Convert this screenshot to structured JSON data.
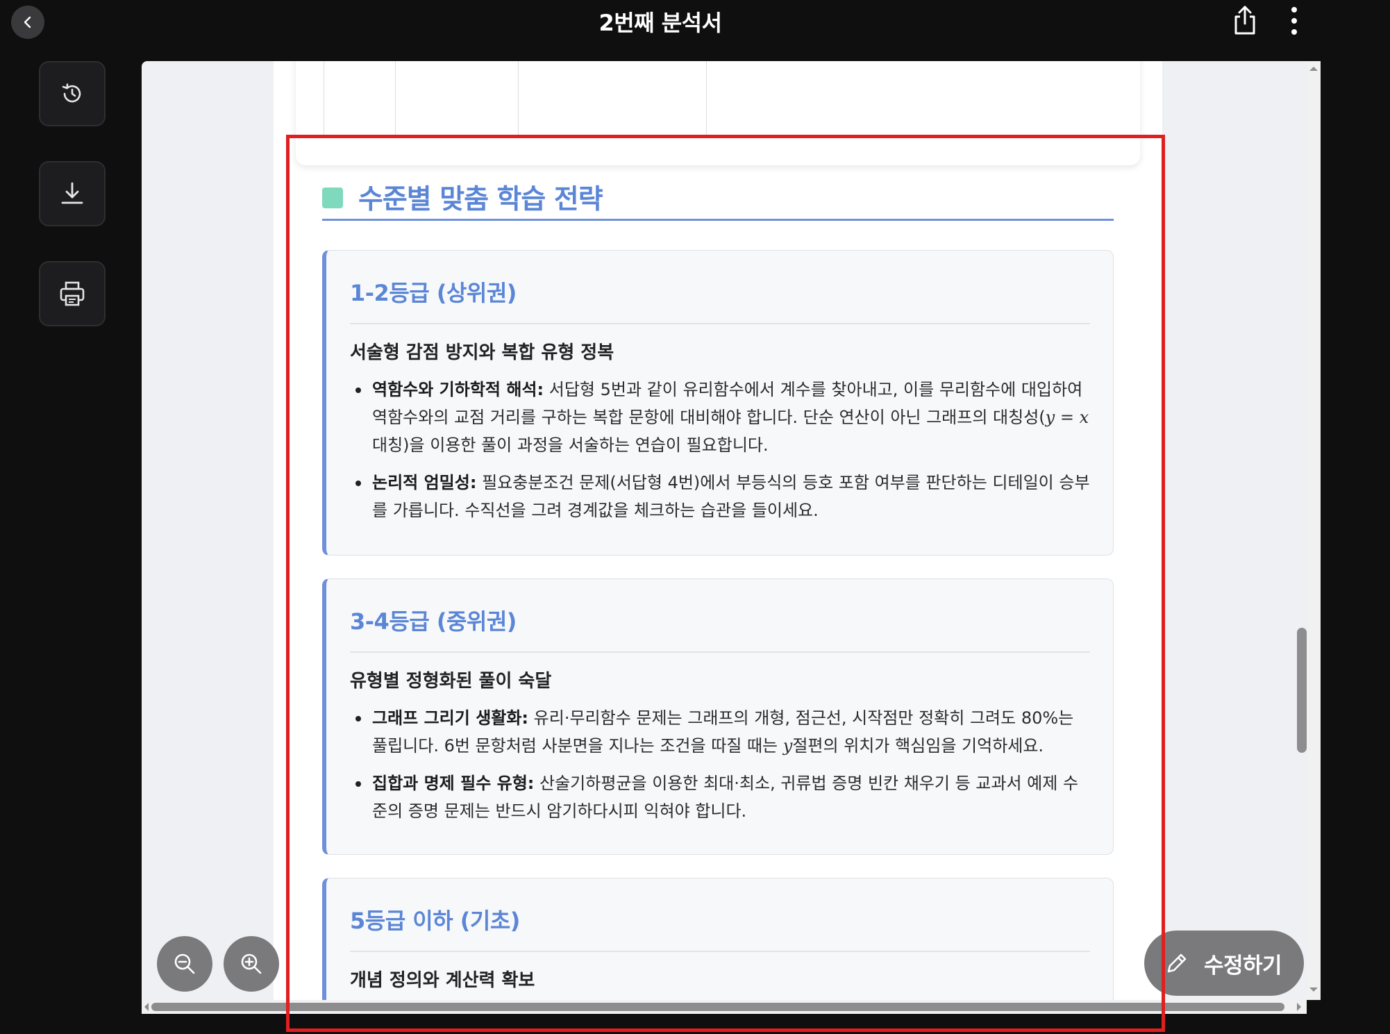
{
  "header": {
    "title": "2번째 분석서"
  },
  "icons": {
    "back": "chevron-left-icon",
    "share": "share-icon",
    "more": "more-vertical-icon",
    "history": "history-icon",
    "download": "download-icon",
    "print": "printer-icon",
    "zoom_out": "zoom-out-icon",
    "zoom_in": "zoom-in-icon",
    "edit": "pencil-icon"
  },
  "section": {
    "title": "수준별 맞춤 학습 전략"
  },
  "cards": [
    {
      "title": "1-2등급 (상위권)",
      "subtitle": "서술형 감점 방지와 복합 유형 정복",
      "bullets": [
        {
          "label": "역함수와 기하학적 해석:",
          "text_before": " 서답형 5번과 같이 유리함수에서 계수를 찾아내고, 이를 무리함수에 대입하여 역함수와의 교점 거리를 구하는 복합 문항에 대비해야 합니다. 단순 연산이 아닌 그래프의 대칭성(",
          "math": "y = x",
          "text_after": " 대칭)을 이용한 풀이 과정을 서술하는 연습이 필요합니다."
        },
        {
          "label": "논리적 엄밀성:",
          "text_before": " 필요충분조건 문제(서답형 4번)에서 부등식의 등호 포함 여부를 판단하는 디테일이 승부를 가릅니다. 수직선을 그려 경계값을 체크하는 습관을 들이세요.",
          "math": "",
          "text_after": ""
        }
      ]
    },
    {
      "title": "3-4등급 (중위권)",
      "subtitle": "유형별 정형화된 풀이 숙달",
      "bullets": [
        {
          "label": "그래프 그리기 생활화:",
          "text_before": " 유리·무리함수 문제는 그래프의 개형, 점근선, 시작점만 정확히 그려도 80%는 풀립니다. 6번 문항처럼 사분면을 지나는 조건을 따질 때는 ",
          "math": "y",
          "text_after": "절편의 위치가 핵심임을 기억하세요."
        },
        {
          "label": "집합과 명제 필수 유형:",
          "text_before": " 산술기하평균을 이용한 최대·최소, 귀류법 증명 빈칸 채우기 등 교과서 예제 수준의 증명 문제는 반드시 암기하다시피 익혀야 합니다.",
          "math": "",
          "text_after": ""
        }
      ]
    },
    {
      "title": "5등급 이하 (기초)",
      "subtitle": "개념 정의와 계산력 확보",
      "bullets": []
    }
  ],
  "edit_button": {
    "label": "수정하기"
  }
}
